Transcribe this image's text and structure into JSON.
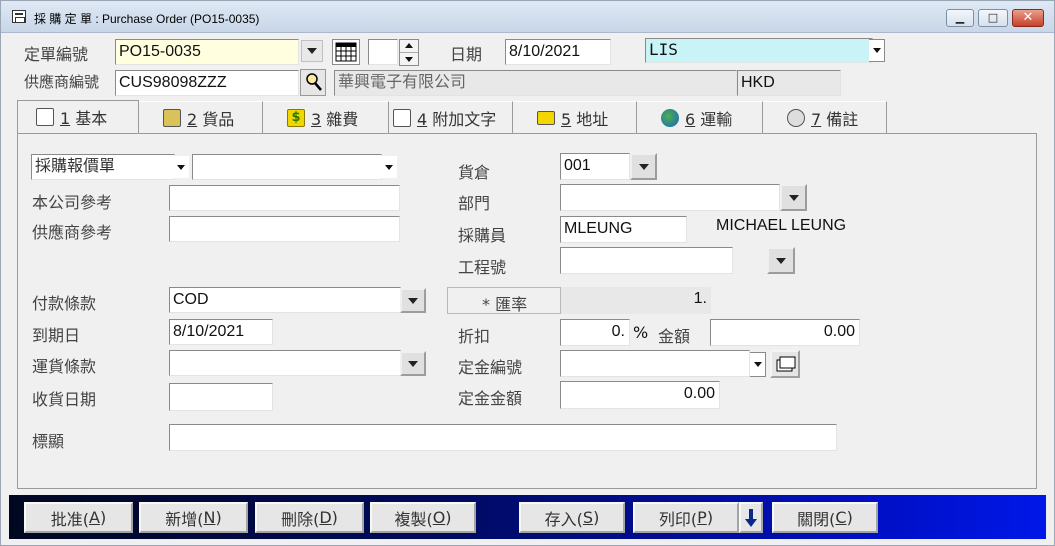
{
  "window": {
    "title": "採 購 定 單 : Purchase Order (PO15-0035)"
  },
  "header": {
    "order_no_label": "定單編號",
    "order_no": "PO15-0035",
    "date_label": "日期",
    "date": "8/10/2021",
    "location": "LIS",
    "supplier_no_label": "供應商編號",
    "supplier_no": "CUS98098ZZZ",
    "supplier_name": "華興電子有限公司",
    "currency": "HKD"
  },
  "tabs": [
    {
      "num": "1",
      "label": "基本"
    },
    {
      "num": "2",
      "label": "貨品"
    },
    {
      "num": "3",
      "label": "雜費"
    },
    {
      "num": "4",
      "label": "附加文字"
    },
    {
      "num": "5",
      "label": "地址"
    },
    {
      "num": "6",
      "label": "運輸"
    },
    {
      "num": "7",
      "label": "備註"
    }
  ],
  "basic": {
    "doc_type": "採購報價單",
    "doc_type2": "",
    "company_ref_label": "本公司參考",
    "company_ref": "",
    "supplier_ref_label": "供應商參考",
    "supplier_ref": "",
    "warehouse_label": "貨倉",
    "warehouse": "001",
    "department_label": "部門",
    "department": "",
    "buyer_label": "採購員",
    "buyer_code": "MLEUNG",
    "buyer_name": "MICHAEL LEUNG",
    "project_label": "工程號",
    "project": "",
    "payment_terms_label": "付款條款",
    "payment_terms": "COD",
    "exchange_rate_label": "* 匯率",
    "exchange_rate": "1.",
    "due_date_label": "到期日",
    "due_date": "8/10/2021",
    "discount_label": "折扣",
    "discount": "0.",
    "percent": "%",
    "amount_label": "金額",
    "amount": "0.00",
    "shipping_terms_label": "運貨條款",
    "shipping_terms": "",
    "deposit_no_label": "定金編號",
    "deposit_no": "",
    "receive_date_label": "收貨日期",
    "receive_date": "",
    "deposit_amount_label": "定金金額",
    "deposit_amount": "0.00",
    "subject_label": "標顯",
    "subject": ""
  },
  "footer": {
    "approve": {
      "text": "批准(",
      "key": "A",
      "end": ")"
    },
    "new": {
      "text": "新增(",
      "key": "N",
      "end": ")"
    },
    "delete": {
      "text": "刪除(",
      "key": "D",
      "end": ")"
    },
    "copy": {
      "text": "複製(",
      "key": "O",
      "end": ")"
    },
    "save": {
      "text": "存入(",
      "key": "S",
      "end": ")"
    },
    "print": {
      "text": "列印(",
      "key": "P",
      "end": ")"
    },
    "close": {
      "text": "關閉(",
      "key": "C",
      "end": ")"
    }
  }
}
